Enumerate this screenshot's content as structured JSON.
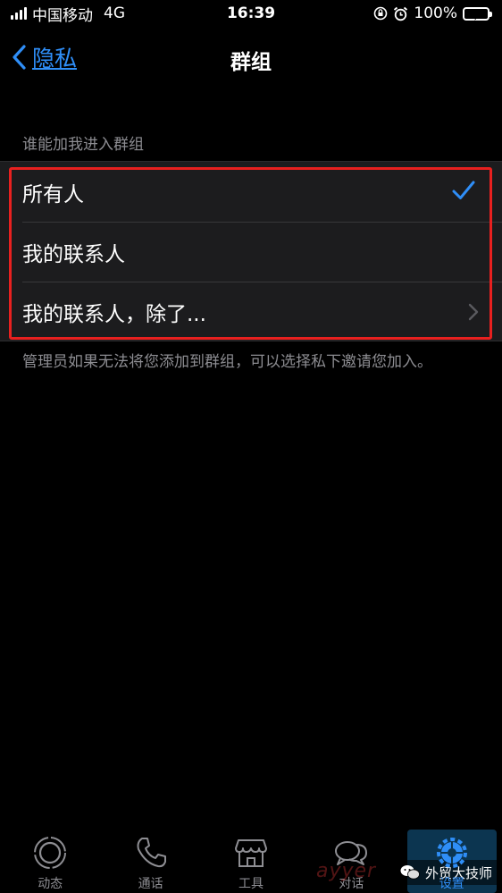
{
  "status_bar": {
    "carrier": "中国移动",
    "network": "4G",
    "time": "16:39",
    "battery": "100%"
  },
  "nav": {
    "back_label": "隐私",
    "title": "群组"
  },
  "section": {
    "header": "谁能加我进入群组",
    "options": [
      {
        "label": "所有人",
        "selected": true
      },
      {
        "label": "我的联系人",
        "selected": false
      },
      {
        "label": "我的联系人，除了...",
        "selected": false
      }
    ],
    "footer": "管理员如果无法将您添加到群组，可以选择私下邀请您加入。"
  },
  "tabs": [
    {
      "label": "动态",
      "icon": "status-icon",
      "active": false
    },
    {
      "label": "通话",
      "icon": "phone-icon",
      "active": false
    },
    {
      "label": "工具",
      "icon": "store-icon",
      "active": false
    },
    {
      "label": "对话",
      "icon": "chats-icon",
      "active": false
    },
    {
      "label": "设置",
      "icon": "gear-icon",
      "active": true
    }
  ],
  "watermark": {
    "text": "ayyer",
    "badge": "外贸大技师"
  },
  "colors": {
    "accent": "#2f8ef7",
    "highlight": "#e8201f",
    "cell_bg": "#1c1c1e",
    "secondary_text": "#8d8d92"
  }
}
